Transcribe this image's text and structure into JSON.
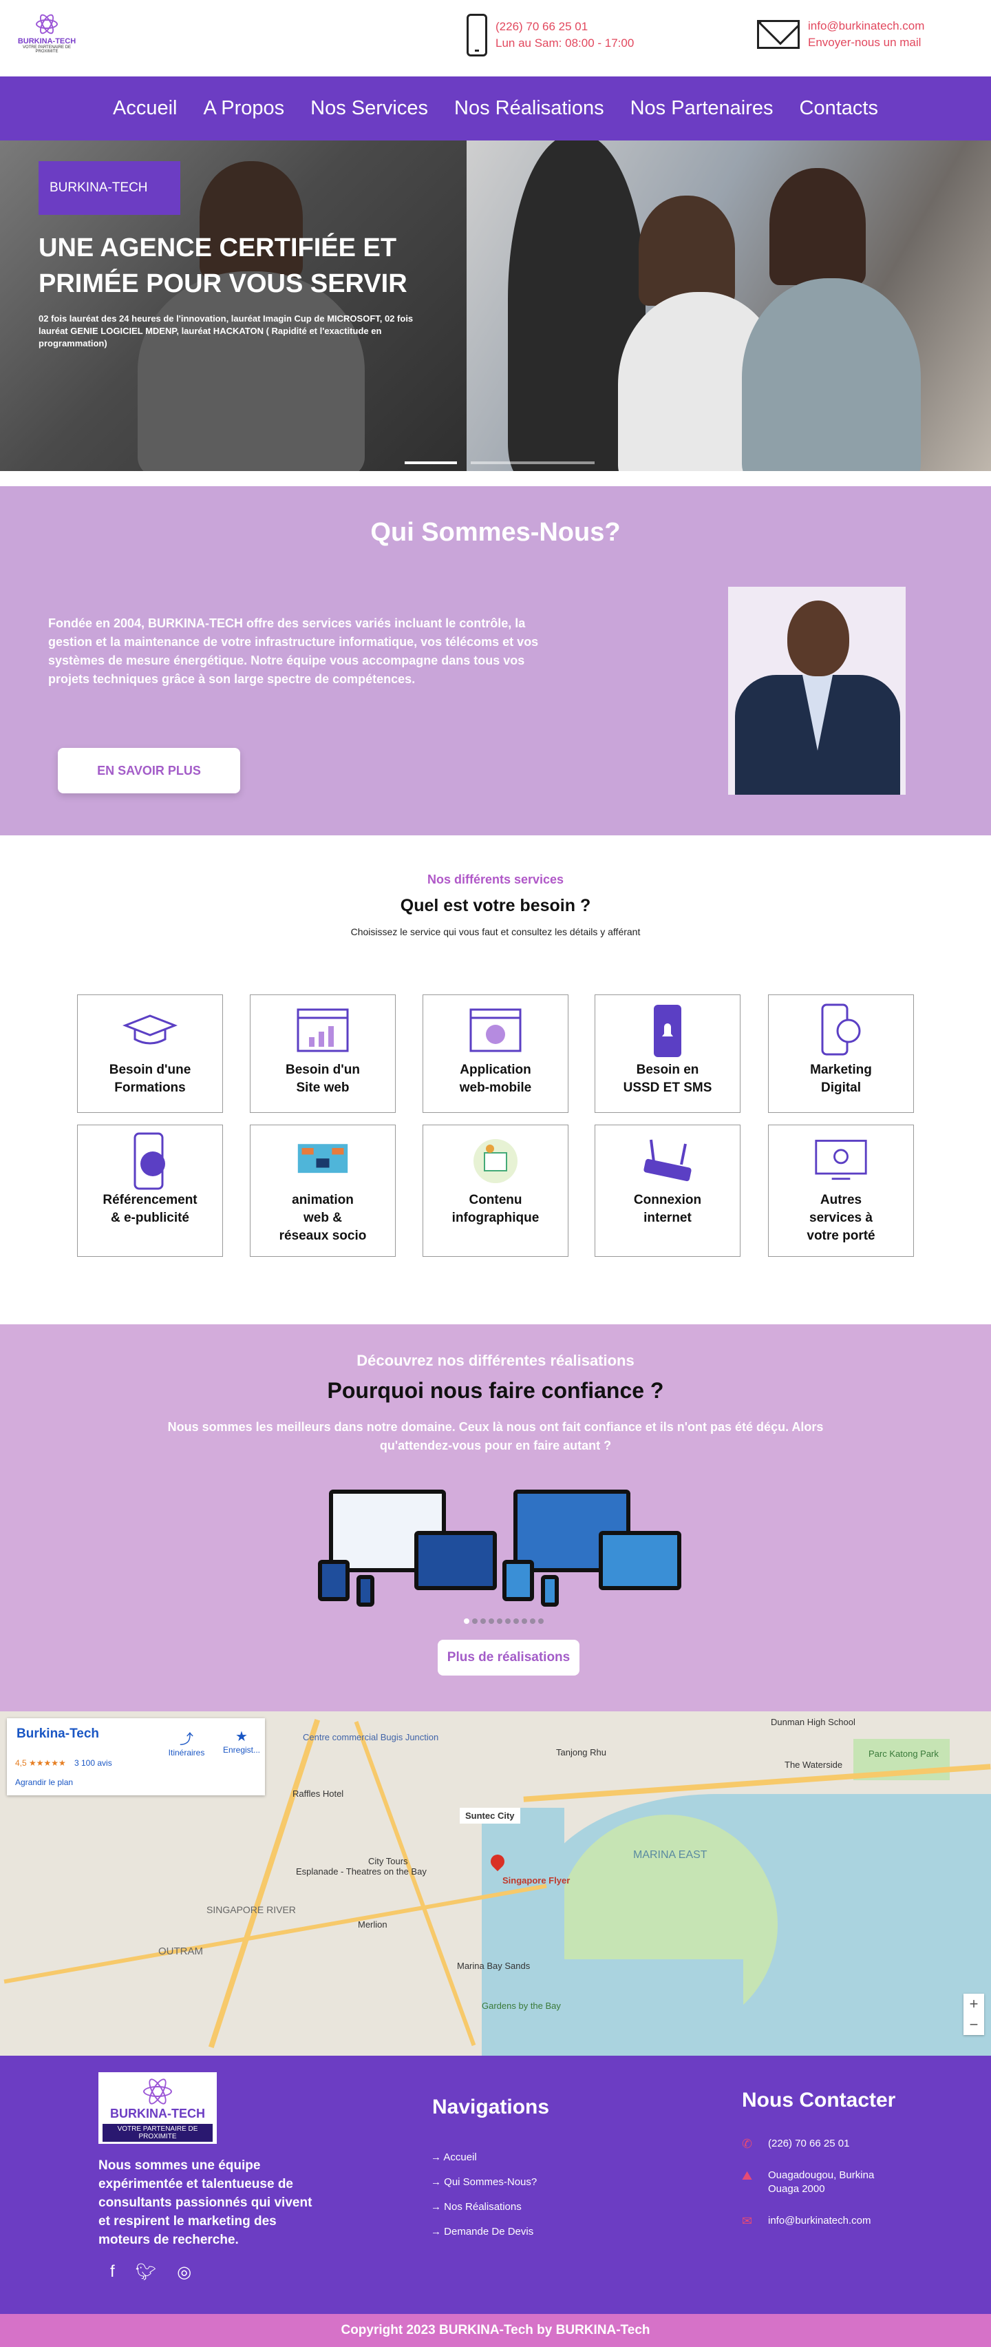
{
  "brand": {
    "logo_name": "BURKINA-TECH",
    "logo_tagline": "VOTRE PARTENAIRE DE PROXIMITE"
  },
  "header": {
    "phone": "(226) 70 66 25 01",
    "hours": "Lun au Sam: 08:00 - 17:00",
    "email": "info@burkinatech.com",
    "email_cta": "Envoyer-nous un mail"
  },
  "nav": {
    "items": [
      "Accueil",
      "A Propos",
      "Nos  Services",
      "Nos Réalisations",
      "Nos Partenaires",
      "Contacts"
    ]
  },
  "hero": {
    "badge": "BURKINA-TECH",
    "title": "UNE AGENCE CERTIFIÉE ET PRIMÉE POUR VOUS SERVIR",
    "subtitle": "02 fois lauréat des 24 heures de l'innovation, lauréat Imagin Cup de MICROSOFT, 02 fois lauréat GENIE LOGICIEL MDENP, lauréat HACKATON ( Rapidité et l'exactitude en programmation)"
  },
  "about": {
    "title": "Qui Sommes-Nous?",
    "text": "Fondée en 2004, BURKINA-TECH offre des services variés incluant le contrôle, la gestion et la maintenance de votre infrastructure informatique, vos télécoms et vos systèmes de mesure énergétique. Notre équipe vous accompagne dans tous vos projets techniques grâce à son large spectre de compétences.",
    "button": "EN SAVOIR PLUS"
  },
  "services": {
    "kicker": "Nos différents services",
    "title": "Quel est votre besoin ?",
    "lead": "Choisissez le service qui vous faut et consultez les détails y afférant",
    "items": [
      {
        "label": "Besoin d'une\nFormations",
        "icon": "graduation-cap-icon"
      },
      {
        "label": "Besoin d'un\nSite web",
        "icon": "website-chart-icon"
      },
      {
        "label": "Application\nweb-mobile",
        "icon": "web-app-icon"
      },
      {
        "label": "Besoin en\nUSSD ET SMS",
        "icon": "mobile-notification-icon"
      },
      {
        "label": "Marketing\nDigital",
        "icon": "phone-chat-icon"
      },
      {
        "label": "Référencement\n& e-publicité",
        "icon": "megaphone-phone-icon"
      },
      {
        "label": "animation\nweb &\nréseaux socio",
        "icon": "network-icon"
      },
      {
        "label": "Contenu\ninfographique",
        "icon": "infographic-icon"
      },
      {
        "label": "Connexion\ninternet",
        "icon": "router-icon"
      },
      {
        "label": "Autres\nservices à\nvotre porté",
        "icon": "idea-screen-icon"
      }
    ]
  },
  "realisations": {
    "kicker": "Découvrez nos différentes réalisations",
    "title": "Pourquoi nous faire confiance ?",
    "text": "Nous sommes les meilleurs dans notre domaine. Ceux là nous ont fait confiance et ils n'ont pas été déçu. Alors qu'attendez-vous pour en faire autant ?",
    "button": "Plus de réalisations"
  },
  "map": {
    "place": "Burkina-Tech",
    "rating": "4,5 ★★★★★",
    "reviews": "3 100 avis",
    "enlarge": "Agrandir le plan",
    "directions": "Itinéraires",
    "save": "Enregist...",
    "labels": [
      "Suntec City",
      "Singapore Flyer",
      "MARINA EAST",
      "OUTRAM",
      "SINGAPORE RIVER",
      "Centre commercial Bugis Junction",
      "Raffles Hotel",
      "Esplanade - Theatres on the Bay",
      "Marina Bay Sands",
      "Gardens by the Bay",
      "City Tours",
      "Merlion",
      "Tanjong Rhu",
      "The Waterside",
      "Parc Katong Park",
      "Dunman High School"
    ]
  },
  "footer": {
    "logo_name": "BURKINA-TECH",
    "logo_tagline": "VOTRE PARTENAIRE DE PROXIMITE",
    "about": "Nous sommes une équipe expérimentée et talentueuse de consultants passionnés qui vivent et respirent le marketing des moteurs de recherche.",
    "nav_title": "Navigations",
    "nav_items": [
      "Accueil",
      "Qui Sommes-Nous?",
      "Nos Réalisations",
      "Demande De Devis"
    ],
    "contact_title": "Nous Contacter",
    "phone": "(226) 70 66 25 01",
    "address": "Ouagadougou, Burkina Ouaga 2000",
    "email": "info@burkinatech.com"
  },
  "copyright": "Copyright 2023 BURKINA-Tech by BURKINA-Tech"
}
